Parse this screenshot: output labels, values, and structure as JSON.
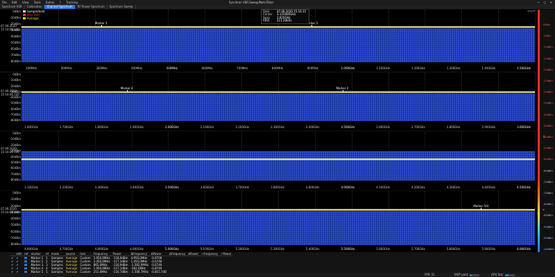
{
  "menu": {
    "items": [
      "File",
      "Edit",
      "View",
      "Tools",
      "Extras",
      "?",
      "Tracking"
    ],
    "window_title": "Synchron VSR.Sweep/Notc/Total",
    "controls": "— ▢ ✕"
  },
  "tabs": [
    {
      "label": "Spectrum VSR",
      "active": false
    },
    {
      "label": "Calibration",
      "active": false
    },
    {
      "label": "Channel Spectrum",
      "active": true
    },
    {
      "label": "RF Power Spectrum",
      "active": false
    },
    {
      "label": "Spectrum Sweep",
      "active": false
    }
  ],
  "legend": [
    {
      "label": "Sample/Hold",
      "color": "#ffffff"
    },
    {
      "label": "Max Hold",
      "color": "#ff3030"
    },
    {
      "label": "Average",
      "color": "#ffe000"
    }
  ],
  "info": {
    "rows": [
      {
        "key": "Date",
        "value": "07.09.2020 15:16:15"
      },
      {
        "key": "Center",
        "value": "3.125000GHz"
      },
      {
        "key": "Span",
        "value": "3.925GHz"
      },
      {
        "key": "RBW",
        "value": "211.20kHz"
      }
    ]
  },
  "hud": {
    "label": "RTS|MF"
  },
  "panels": [
    {
      "y_labels": [
        "0dBm",
        "-10dBm",
        "-20dBm",
        "-30dBm",
        "-40dBm",
        "-50dBm",
        "-60dBm",
        "-70dBm",
        "-80dBm"
      ],
      "timestamp": [
        "07.09.2020",
        "15:16:06.140"
      ],
      "markers": [
        {
          "label": "Marker 1",
          "pos": 0.155
        },
        {
          "label": "Marker 3",
          "pos": 0.565
        }
      ],
      "x_labels": [
        {
          "t": "100MHz",
          "bold": false
        },
        {
          "t": "200MHz",
          "bold": false
        },
        {
          "t": "300MHz",
          "bold": false
        },
        {
          "t": "400MHz",
          "bold": false
        },
        {
          "t": "500MHz",
          "bold": true
        },
        {
          "t": "600MHz",
          "bold": false
        },
        {
          "t": "700MHz",
          "bold": false
        },
        {
          "t": "800MHz",
          "bold": false
        },
        {
          "t": "900MHz",
          "bold": false
        },
        {
          "t": "1.000GHz",
          "bold": true
        },
        {
          "t": "1.100GHz",
          "bold": false
        },
        {
          "t": "1.200GHz",
          "bold": false
        },
        {
          "t": "1.300GHz",
          "bold": false
        },
        {
          "t": "1.400GHz",
          "bold": false
        },
        {
          "t": "1.500GHz",
          "bold": true
        }
      ]
    },
    {
      "y_labels": [
        "0dBm",
        "-10dBm",
        "-20dBm",
        "-30dBm",
        "-40dBm",
        "-50dBm",
        "-60dBm",
        "-70dBm",
        "-80dBm"
      ],
      "timestamp": [
        "07.09.2020",
        "15:16:06.140"
      ],
      "markers": [
        {
          "label": "Marker 4",
          "pos": 0.205
        },
        {
          "label": "Marker 2",
          "pos": 0.625
        }
      ],
      "x_labels": [
        {
          "t": "1.600GHz",
          "bold": false
        },
        {
          "t": "1.700GHz",
          "bold": false
        },
        {
          "t": "1.800GHz",
          "bold": false
        },
        {
          "t": "1.900GHz",
          "bold": false
        },
        {
          "t": "2.000GHz",
          "bold": true
        },
        {
          "t": "2.100GHz",
          "bold": false
        },
        {
          "t": "2.200GHz",
          "bold": false
        },
        {
          "t": "2.300GHz",
          "bold": false
        },
        {
          "t": "2.400GHz",
          "bold": false
        },
        {
          "t": "2.500GHz",
          "bold": true
        },
        {
          "t": "2.600GHz",
          "bold": false
        },
        {
          "t": "2.700GHz",
          "bold": false
        },
        {
          "t": "2.800GHz",
          "bold": false
        },
        {
          "t": "2.900GHz",
          "bold": false
        },
        {
          "t": "3.000GHz",
          "bold": true
        }
      ]
    },
    {
      "y_labels": [
        "0dBm",
        "-10dBm",
        "-20dBm",
        "-30dBm",
        "-40dBm",
        "-50dBm",
        "-60dBm",
        "-70dBm",
        "-80dBm"
      ],
      "timestamp": [
        "07.09.2020",
        "15:16:06.140"
      ],
      "markers": [],
      "x_labels": [
        {
          "t": "3.100GHz",
          "bold": false
        },
        {
          "t": "3.200GHz",
          "bold": false
        },
        {
          "t": "3.300GHz",
          "bold": false
        },
        {
          "t": "3.400GHz",
          "bold": false
        },
        {
          "t": "3.500GHz",
          "bold": true
        },
        {
          "t": "3.600GHz",
          "bold": false
        },
        {
          "t": "3.700GHz",
          "bold": false
        },
        {
          "t": "3.800GHz",
          "bold": false
        },
        {
          "t": "3.900GHz",
          "bold": false
        },
        {
          "t": "4.000GHz",
          "bold": true
        },
        {
          "t": "4.100GHz",
          "bold": false
        },
        {
          "t": "4.200GHz",
          "bold": false
        },
        {
          "t": "4.300GHz",
          "bold": false
        },
        {
          "t": "4.400GHz",
          "bold": false
        },
        {
          "t": "4.500GHz",
          "bold": true
        }
      ]
    },
    {
      "y_labels": [
        "0dBm",
        "-10dBm",
        "-20dBm",
        "-30dBm",
        "-40dBm",
        "-50dBm",
        "-60dBm",
        "-70dBm",
        "-80dBm"
      ],
      "timestamp": [
        "07.09.2020",
        "15:16:06.140"
      ],
      "markers": [
        {
          "label": "Marker 5(I)",
          "pos": 0.895
        }
      ],
      "x_labels": [
        {
          "t": "4.600GHz",
          "bold": false
        },
        {
          "t": "4.700GHz",
          "bold": false
        },
        {
          "t": "4.800GHz",
          "bold": false
        },
        {
          "t": "4.900GHz",
          "bold": false
        },
        {
          "t": "5.000GHz",
          "bold": true
        },
        {
          "t": "5.100GHz",
          "bold": false
        },
        {
          "t": "5.200GHz",
          "bold": false
        },
        {
          "t": "5.300GHz",
          "bold": false
        },
        {
          "t": "5.400GHz",
          "bold": false
        },
        {
          "t": "5.500GHz",
          "bold": true
        },
        {
          "t": "5.600GHz",
          "bold": false
        },
        {
          "t": "5.700GHz",
          "bold": false
        },
        {
          "t": "5.800GHz",
          "bold": false
        },
        {
          "t": "5.900GHz",
          "bold": false
        },
        {
          "t": "6.000GHz",
          "bold": true
        }
      ]
    }
  ],
  "right_scale": {
    "labels": [
      "0dBm",
      "-5dBm",
      "-10dBm",
      "-15dBm",
      "-20dBm",
      "-25dBm",
      "-30dBm",
      "-35dBm",
      "-40dBm",
      "-45dBm",
      "-50dBm",
      "-55dBm",
      "-60dBm",
      "-65dBm",
      "-70dBm",
      "-75dBm",
      "-80dBm",
      "-85dBm",
      "-90dBm",
      "-95dBm",
      "-100dBm"
    ]
  },
  "marker_table": {
    "headers": [
      "",
      "edit",
      "ref",
      "marker",
      "id",
      "mode",
      "source",
      "lock",
      "Frequency",
      "Power",
      "ΔFrequency",
      "ΔPower",
      "ΔFrequency",
      "ΔPower",
      "~Frequency",
      "~Power"
    ],
    "rows": [
      [
        "✔",
        "✔",
        "",
        "Marker 1",
        "1",
        "Samples",
        "Average",
        "Custom",
        "5.950,0MHz",
        "-118,9dBm",
        "4,950,0MHz",
        "-0,9708",
        "",
        "",
        "",
        ""
      ],
      [
        "✔",
        "✔",
        "",
        "Marker 2",
        "2",
        "Samples",
        "Average",
        "Custom",
        "2.450,0MHz",
        "-117,3dBm",
        "1.450,0MHz",
        "-0,6748",
        "",
        "",
        "",
        ""
      ],
      [
        "✔",
        "✔",
        "",
        "Marker 3",
        "3",
        "Samples",
        "Average",
        "Custom",
        "865,0MHz",
        "-116,9dBm",
        "-1.582,0MHz",
        "-0,6749",
        "",
        "",
        "",
        ""
      ],
      [
        "✔",
        "✔",
        "",
        "Marker 4",
        "4",
        "Samples",
        "Average",
        "Custom",
        "1.950,0MHz",
        "-117,1dBm",
        "-582,0MHz",
        "-0,8749",
        "",
        "",
        "",
        ""
      ],
      [
        "✔",
        "✔",
        "",
        "Marker 5",
        "5",
        "Samples",
        "Average",
        "Custom",
        "251,0MHz",
        "-116,7dBm",
        "-1.508,7MHz",
        "-0,815,7dB",
        "",
        "",
        "",
        ""
      ]
    ],
    "swatch_color": "#2b76d9"
  },
  "status": {
    "items": [
      {
        "label": "FPS: 51",
        "value": null
      },
      {
        "label": "DSP Load:",
        "value": 0.22
      },
      {
        "label": "GPU Sat:",
        "value": 0.4
      }
    ]
  }
}
